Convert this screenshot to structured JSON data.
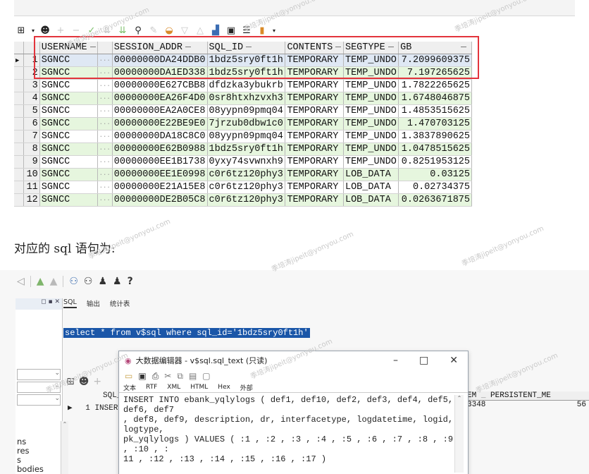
{
  "grid": {
    "columns": [
      "USERNAME",
      "SESSION_ADDR",
      "SQL_ID",
      "CONTENTS",
      "SEGTYPE",
      "GB"
    ],
    "rows": [
      {
        "n": "1",
        "user": "SGNCC",
        "addr": "00000000DA24DDB0",
        "sql": "1bdz5sry0ft1h",
        "cont": "TEMPORARY",
        "seg": "TEMP_UNDO",
        "gb": "7.2099609375"
      },
      {
        "n": "2",
        "user": "SGNCC",
        "addr": "00000000DA1ED338",
        "sql": "1bdz5sry0ft1h",
        "cont": "TEMPORARY",
        "seg": "TEMP_UNDO",
        "gb": "7.197265625"
      },
      {
        "n": "3",
        "user": "SGNCC",
        "addr": "00000000E627CBB8",
        "sql": "dfdzka3ybukrb",
        "cont": "TEMPORARY",
        "seg": "TEMP_UNDO",
        "gb": "1.7822265625"
      },
      {
        "n": "4",
        "user": "SGNCC",
        "addr": "00000000EA26F4D0",
        "sql": "0sr8htxhzvxh3",
        "cont": "TEMPORARY",
        "seg": "TEMP_UNDO",
        "gb": "1.6748046875"
      },
      {
        "n": "5",
        "user": "SGNCC",
        "addr": "00000000EA2A0CE8",
        "sql": "08yypn09pmq04",
        "cont": "TEMPORARY",
        "seg": "TEMP_UNDO",
        "gb": "1.4853515625"
      },
      {
        "n": "6",
        "user": "SGNCC",
        "addr": "00000000E22BE9E0",
        "sql": "7jrzub0dbw1c0",
        "cont": "TEMPORARY",
        "seg": "TEMP_UNDO",
        "gb": "1.470703125"
      },
      {
        "n": "7",
        "user": "SGNCC",
        "addr": "00000000DA18C8C0",
        "sql": "08yypn09pmq04",
        "cont": "TEMPORARY",
        "seg": "TEMP_UNDO",
        "gb": "1.3837890625"
      },
      {
        "n": "8",
        "user": "SGNCC",
        "addr": "00000000E62B0988",
        "sql": "1bdz5sry0ft1h",
        "cont": "TEMPORARY",
        "seg": "TEMP_UNDO",
        "gb": "1.0478515625"
      },
      {
        "n": "9",
        "user": "SGNCC",
        "addr": "00000000EE1B1738",
        "sql": "0yxy74svwnxh9",
        "cont": "TEMPORARY",
        "seg": "TEMP_UNDO",
        "gb": "0.8251953125"
      },
      {
        "n": "10",
        "user": "SGNCC",
        "addr": "00000000EE1E0998",
        "sql": "c0r6tz120phy3",
        "cont": "TEMPORARY",
        "seg": "LOB_DATA",
        "gb": "0.03125"
      },
      {
        "n": "11",
        "user": "SGNCC",
        "addr": "00000000E21A15E8",
        "sql": "c0r6tz120phy3",
        "cont": "TEMPORARY",
        "seg": "LOB_DATA",
        "gb": "0.02734375"
      },
      {
        "n": "12",
        "user": "SGNCC",
        "addr": "00000000DE2B05C8",
        "sql": "c0r6tz120phy3",
        "cont": "TEMPORARY",
        "seg": "LOB_DATA",
        "gb": "0.0263671875"
      }
    ],
    "cell_ellipsis": "···"
  },
  "caption": "对应的 sql 语句为:",
  "ide": {
    "tabs": [
      "SQL",
      "输出",
      "统计表"
    ],
    "sql_text": "select * from v$sql where sql_id='1bdz5sry0ft1h'",
    "left_list": [
      "ns",
      "res",
      "s",
      "bodies"
    ],
    "lower_grid": {
      "header": "SQL_TE",
      "row_num": "1",
      "row_val": "INSERT"
    },
    "right_grid": {
      "header_a": "EM",
      "header_b": "PERSISTENT_ME",
      "val_a": "3348",
      "val_b": "56"
    },
    "help_glyph": "?"
  },
  "popup": {
    "title": "大数据编辑器 - v$sql.sql_text (只读)",
    "tabs": [
      "文本",
      "RTF",
      "XML",
      "HTML",
      "Hex",
      "外部"
    ],
    "text": "INSERT INTO ebank_yqlylogs ( def1, def10, def2, def3, def4, def5, def6, def7\n, def8, def9, description, dr, interfacetype, logdatetime, logid, logtype,\npk_yqlylogs ) VALUES ( :1 , :2 , :3 , :4 , :5 , :6 , :7 , :8 , :9 , :10 , :\n11 , :12 , :13 , :14 , :15 , :16 , :17 )",
    "controls": [
      "–",
      "□",
      "✕"
    ]
  },
  "watermark": "季培涛jipeit@yonyou.com",
  "colors": {
    "row_green": "#e6f6de",
    "highlight_red": "#e3343c",
    "selection_blue": "#1a56a8"
  },
  "icons": [
    "grid-icon",
    "user-icon",
    "plus-icon",
    "minus-icon",
    "check-icon",
    "filter-icon",
    "binoculars-icon",
    "pencil-icon",
    "save-icon",
    "print-icon",
    "chart-icon",
    "question-icon"
  ]
}
